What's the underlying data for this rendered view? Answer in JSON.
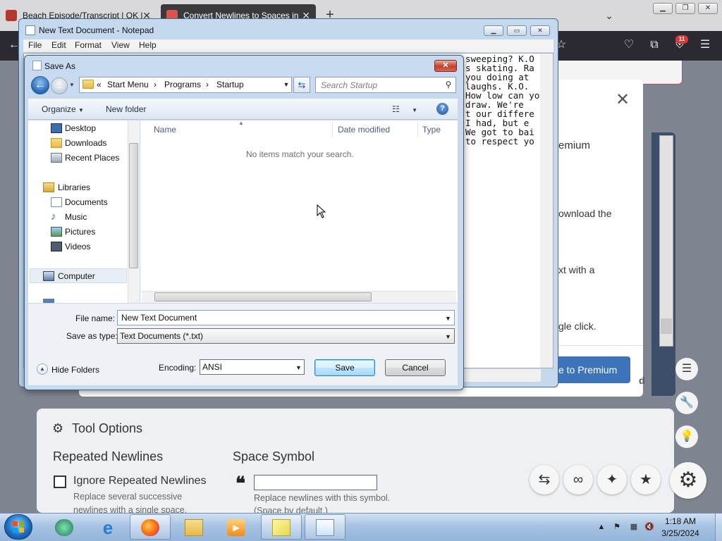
{
  "browser": {
    "tabs": [
      {
        "title": "Beach Episode/Transcript | OK |",
        "active": false
      },
      {
        "title": "Convert Newlines to Spaces in",
        "active": true
      }
    ],
    "new_tab": "+",
    "extension_badge": "11"
  },
  "page": {
    "modal_lines": [
      "emium",
      "ownload the",
      "xt with a",
      "gle click."
    ],
    "premium_button": "e to Premium",
    "footer_fragment": "d",
    "tool_options": {
      "title": "Tool Options",
      "repeated_newlines_heading": "Repeated Newlines",
      "ignore_label": "Ignore Repeated Newlines",
      "ignore_help_1": "Replace several successive",
      "ignore_help_2": "newlines with a single space.",
      "space_symbol_heading": "Space Symbol",
      "space_symbol_value": "",
      "space_help_1": "Replace newlines with this symbol.",
      "space_help_2": "(Space by default.)"
    }
  },
  "notepad": {
    "title": "New Text Document - Notepad",
    "menu": [
      "File",
      "Edit",
      "Format",
      "View",
      "Help"
    ],
    "text_lines": [
      "sweeping? K.O",
      "s skating. Ra",
      "you doing at",
      "laughs. K.O.",
      "How low can yo",
      "draw. We're",
      "t our differe",
      "I had, but e",
      "We got to bai",
      "to respect yo"
    ]
  },
  "save_as": {
    "title": "Save As",
    "breadcrumb": [
      "«",
      "Start Menu",
      "Programs",
      "Startup"
    ],
    "search_placeholder": "Search Startup",
    "toolbar": {
      "organize": "Organize",
      "new_folder": "New folder",
      "help": "?"
    },
    "nav": {
      "desktop": "Desktop",
      "downloads": "Downloads",
      "recent_places": "Recent Places",
      "libraries": "Libraries",
      "documents": "Documents",
      "music": "Music",
      "pictures": "Pictures",
      "videos": "Videos",
      "computer": "Computer"
    },
    "columns": [
      "Name",
      "Date modified",
      "Type"
    ],
    "empty_message": "No items match your search.",
    "file_name_label": "File name:",
    "file_name": "New Text Document",
    "save_as_type_label": "Save as type:",
    "save_as_type": "Text Documents (*.txt)",
    "hide_folders": "Hide Folders",
    "encoding_label": "Encoding:",
    "encoding": "ANSI",
    "save": "Save",
    "cancel": "Cancel"
  },
  "taskbar": {
    "time": "1:18 AM",
    "date": "3/25/2024"
  },
  "colors": {
    "dialog_frame": "#c7daef",
    "premium_button": "#3d73b8",
    "taskbar": "#a7c3e2"
  }
}
